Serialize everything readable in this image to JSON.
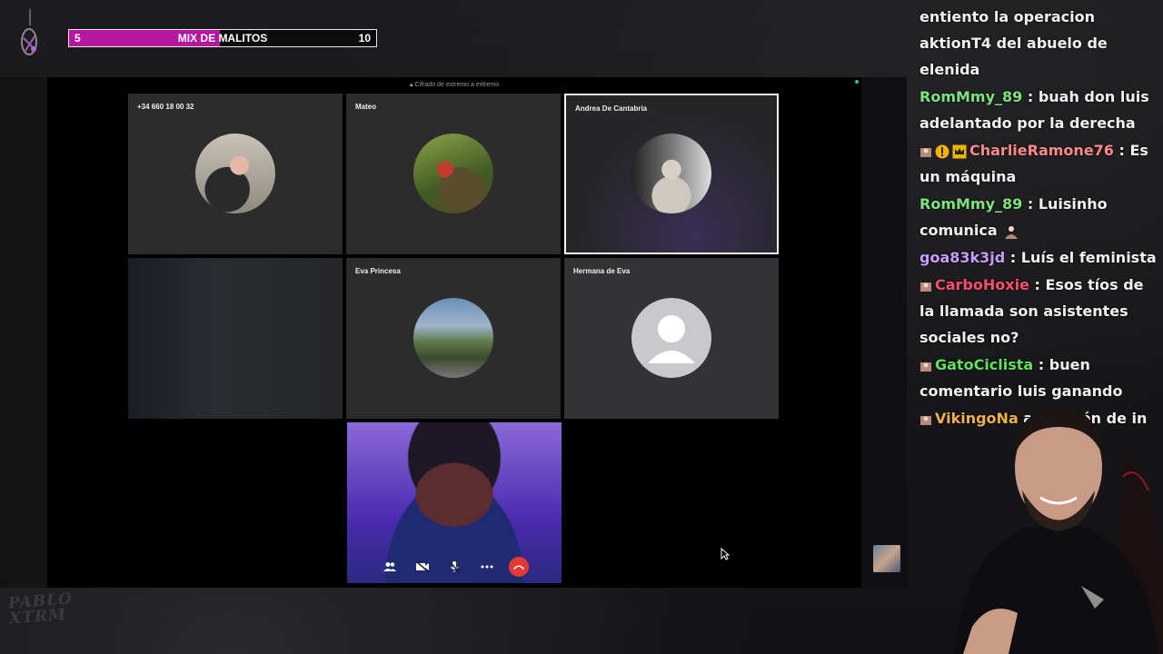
{
  "goal_bar": {
    "min": "5",
    "label": "MIX DE MALITOS",
    "max": "10",
    "progress_percent": 49,
    "fill_color": "#b5179e"
  },
  "call": {
    "encryption_note": "Cifrado de extremo a extremo",
    "participants": [
      {
        "name": "+34 660 18 00 32",
        "avatar": "photo"
      },
      {
        "name": "Mateo",
        "avatar": "photo"
      },
      {
        "name": "Andrea De Cantabria",
        "avatar": "photo",
        "active_speaker": true
      },
      {
        "name": "",
        "avatar": "blurred-video"
      },
      {
        "name": "Eva Princesa",
        "avatar": "photo"
      },
      {
        "name": "Hermana de Eva",
        "avatar": "default-user-icon"
      }
    ],
    "controls": [
      {
        "icon": "participants-icon"
      },
      {
        "icon": "video-off-icon"
      },
      {
        "icon": "mic-off-icon"
      },
      {
        "icon": "more-icon"
      },
      {
        "icon": "end-call-icon",
        "color": "#e53935"
      }
    ]
  },
  "chat": {
    "messages": [
      {
        "user": "",
        "user_color": "#f0f0f0",
        "text": "entiento la operacion aktionT4 del abuelo de elenida",
        "badges": []
      },
      {
        "user": "RomMmy_89",
        "user_color": "#7ee37e",
        "text": " : buah don luis adelantado por la derecha",
        "badges": []
      },
      {
        "user": "CharlieRamone76",
        "user_color": "#ff8a8a",
        "text": " : Es un máquina",
        "badges": [
          "figure-badge",
          "warning-badge",
          "crown-badge"
        ]
      },
      {
        "user": "RomMmy_89",
        "user_color": "#7ee37e",
        "text": " : Luisinho comunica",
        "badges": [],
        "trailing_badge": "figure-badge"
      },
      {
        "user": "goa83k3jd",
        "user_color": "#c89cff",
        "text": " : Luís el feminista",
        "badges": []
      },
      {
        "user": "CarboHoxie",
        "user_color": "#ff4d6d",
        "text": " : Esos tíos de la llamada son asistentes sociales no?",
        "badges": [
          "figure-badge"
        ]
      },
      {
        "user": "GatoCiclista",
        "user_color": "#5fe05f",
        "text": " : buen comentario luis ganando",
        "badges": [
          "figure-badge"
        ]
      },
      {
        "user": "VikingoNa",
        "user_color": "#f0b050",
        "text": " a reunión de in",
        "badges": [
          "figure-badge"
        ]
      }
    ]
  },
  "overlay": {
    "logo_text_line1": "PABLO",
    "logo_text_line2": "XTRM"
  }
}
